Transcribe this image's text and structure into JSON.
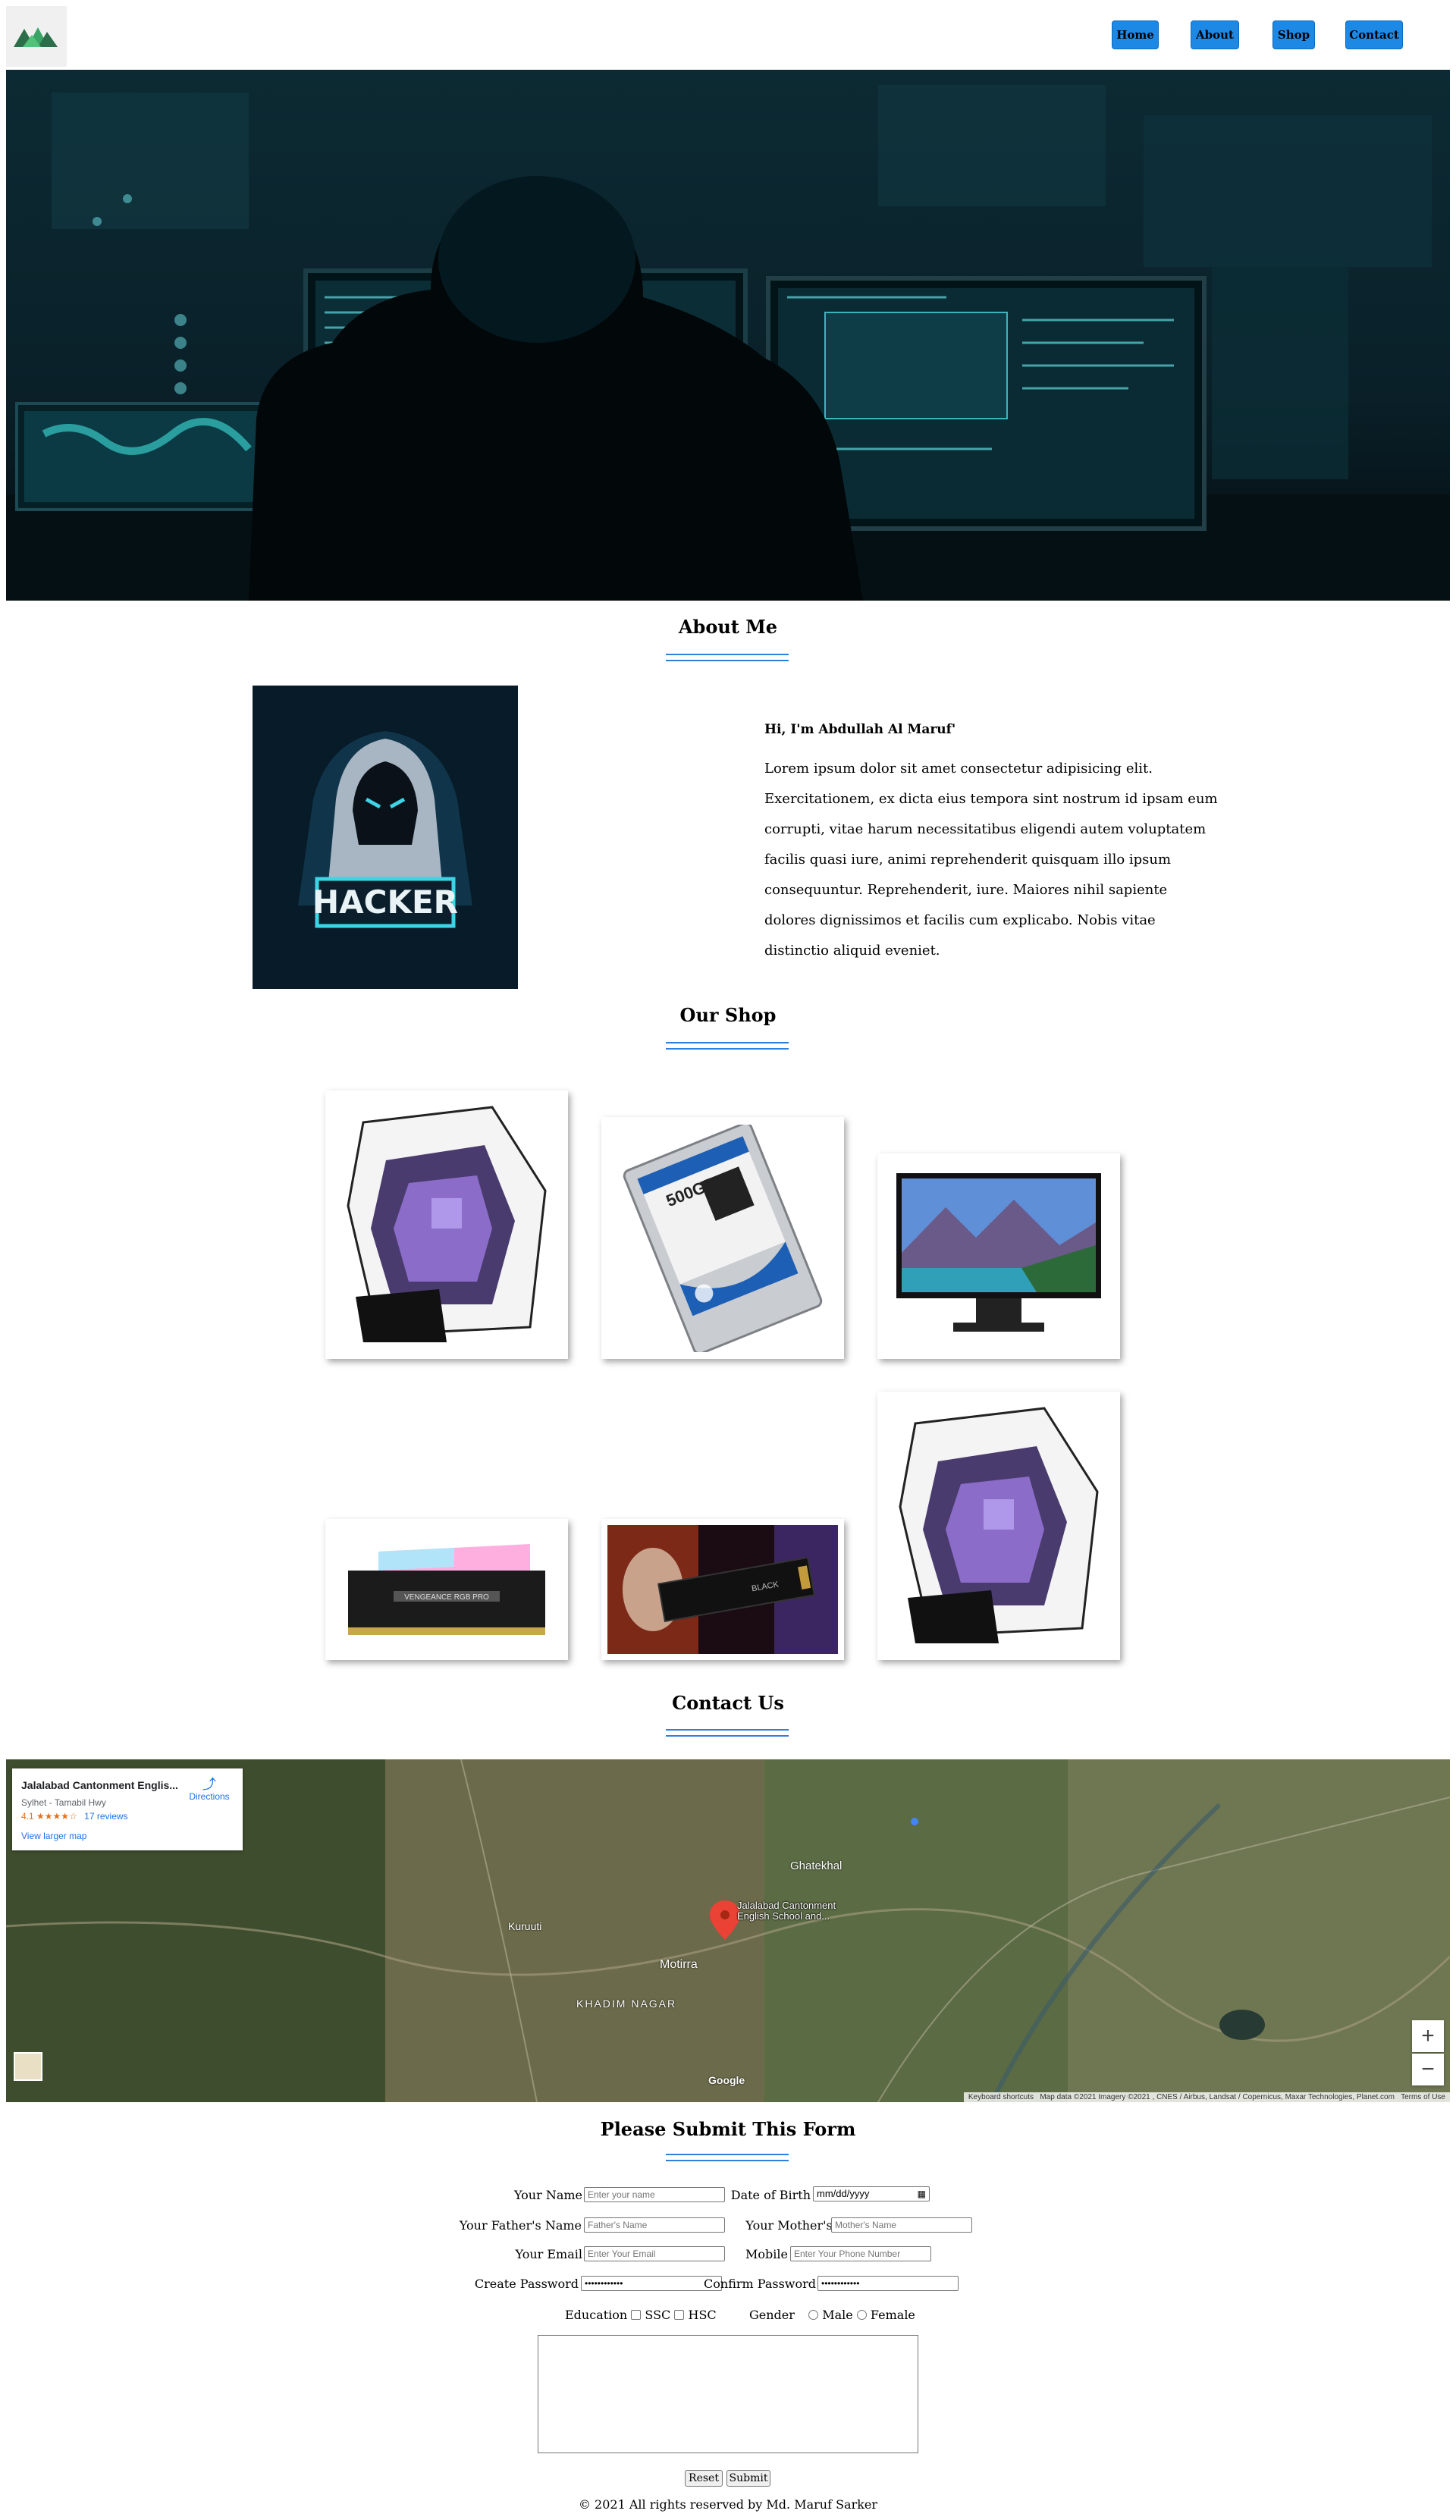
{
  "nav": {
    "home": "Home",
    "about": "About",
    "shop": "Shop",
    "contact": "Contact"
  },
  "about": {
    "title": "About Me",
    "image_text": "HACKER",
    "greeting": "Hi, I'm Abdullah Al Maruf'",
    "body": "Lorem ipsum dolor sit amet consectetur adipisicing elit. Exercitationem, ex dicta eius tempora sint nostrum id ipsam eum corrupti, vitae harum necessitatibus eligendi autem voluptatem facilis quasi iure, animi reprehenderit quisquam illo ipsum consequuntur. Reprehenderit, iure. Maiores nihil sapiente dolores dignissimos et facilis cum explicabo. Nobis vitae distinctio aliquid eveniet."
  },
  "shop": {
    "title": "Our Shop",
    "products": [
      {
        "name": "pc-case",
        "label_text": ""
      },
      {
        "name": "hard-drive",
        "label_text": "500GB"
      },
      {
        "name": "monitor",
        "label_text": ""
      },
      {
        "name": "ram",
        "label_text": "VENGEANCE RGB PRO"
      },
      {
        "name": "ssd",
        "label_text": "BLACK"
      },
      {
        "name": "pc-case",
        "label_text": ""
      }
    ]
  },
  "contact": {
    "title": "Contact Us",
    "map": {
      "place_name": "Jalalabad Cantonment Englis...",
      "address": "Sylhet - Tamabil Hwy",
      "rating": "4.1",
      "stars": "★★★★☆",
      "reviews": "17 reviews",
      "directions": "Directions",
      "larger_map": "View larger map",
      "pin_label_1": "Jalalabad Cantonment",
      "pin_label_2": "English School and...",
      "place_1": "Ghatekhal",
      "place_2": "Kuruuti",
      "place_3": "Motirra",
      "place_4": "KHADIM NAGAR",
      "attribution": "Keyboard shortcuts   Map data ©2021 Imagery ©2021 , CNES / Airbus, Landsat / Copernicus, Maxar Technologies, Planet.com   Terms of Use",
      "google": "Google"
    }
  },
  "form": {
    "title": "Please Submit This Form",
    "your_name_label": "Your Name",
    "your_name_placeholder": "Enter your name",
    "dob_label": "Date of Birth",
    "dob_value": "mm/dd/yyyy",
    "father_label": "Your Father's Name",
    "father_placeholder": "Father's Name",
    "mother_label": "Your Mother's Name",
    "mother_placeholder": "Mother's Name",
    "email_label": "Your Email",
    "email_placeholder": "Enter Your Email",
    "mobile_label": "Mobile",
    "mobile_placeholder": "Enter Your Phone Number",
    "create_password_label": "Create Password",
    "create_password_value": "••••••••••••",
    "confirm_password_label": "Confirm Password",
    "confirm_password_value": "••••••••••••",
    "education_label": "Education",
    "ssc": "SSC",
    "hsc": "HSC",
    "gender_label": "Gender",
    "male": "Male",
    "female": "Female",
    "reset": "Reset",
    "submit": "Submit"
  },
  "footer": {
    "text": "© 2021 All rights reserved by Md. Maruf Sarker"
  },
  "colors": {
    "accent": "#1e88e5",
    "underline": "#2f7fdc"
  }
}
